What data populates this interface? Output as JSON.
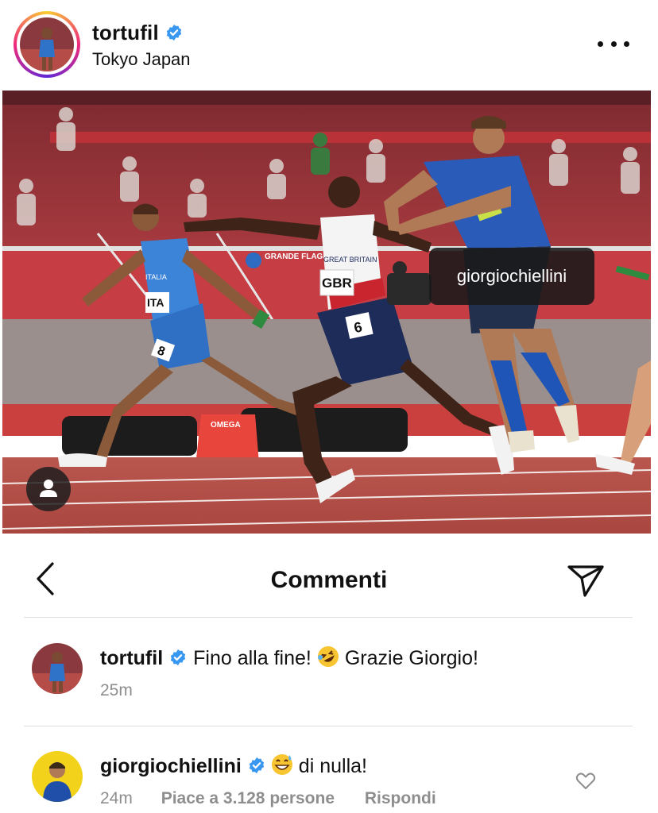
{
  "post": {
    "username": "tortufil",
    "location": "Tokyo Japan",
    "photo_tag": "giorgiochiellini",
    "photo": {
      "sponsor_board": "GRANDE FLAGELLO",
      "bib_left": "ITA",
      "bib_left_shirt": "ITALIA",
      "bib_center": "GBR",
      "shirt_center": "GREAT BRITAIN",
      "lane_center": "6",
      "lane_left": "8",
      "box_brand": "OMEGA"
    }
  },
  "comments_header": {
    "title": "Commenti"
  },
  "comments": [
    {
      "username": "tortufil",
      "text": "Fino alla fine!",
      "text_after": "Grazie Giorgio!",
      "emoji": "rolling-on-floor-laughing",
      "time": "25m"
    },
    {
      "username": "giorgiochiellini",
      "text": "di nulla!",
      "emoji": "grinning-sweat",
      "time": "24m",
      "likes": "Piace a 3.128 persone",
      "reply": "Rispondi"
    }
  ],
  "colors": {
    "verified": "#3897f0",
    "track": "#b8534d",
    "stadium": "#c8333a",
    "italy_blue": "#2f73c9",
    "meta_gray": "#8e8e8e"
  }
}
